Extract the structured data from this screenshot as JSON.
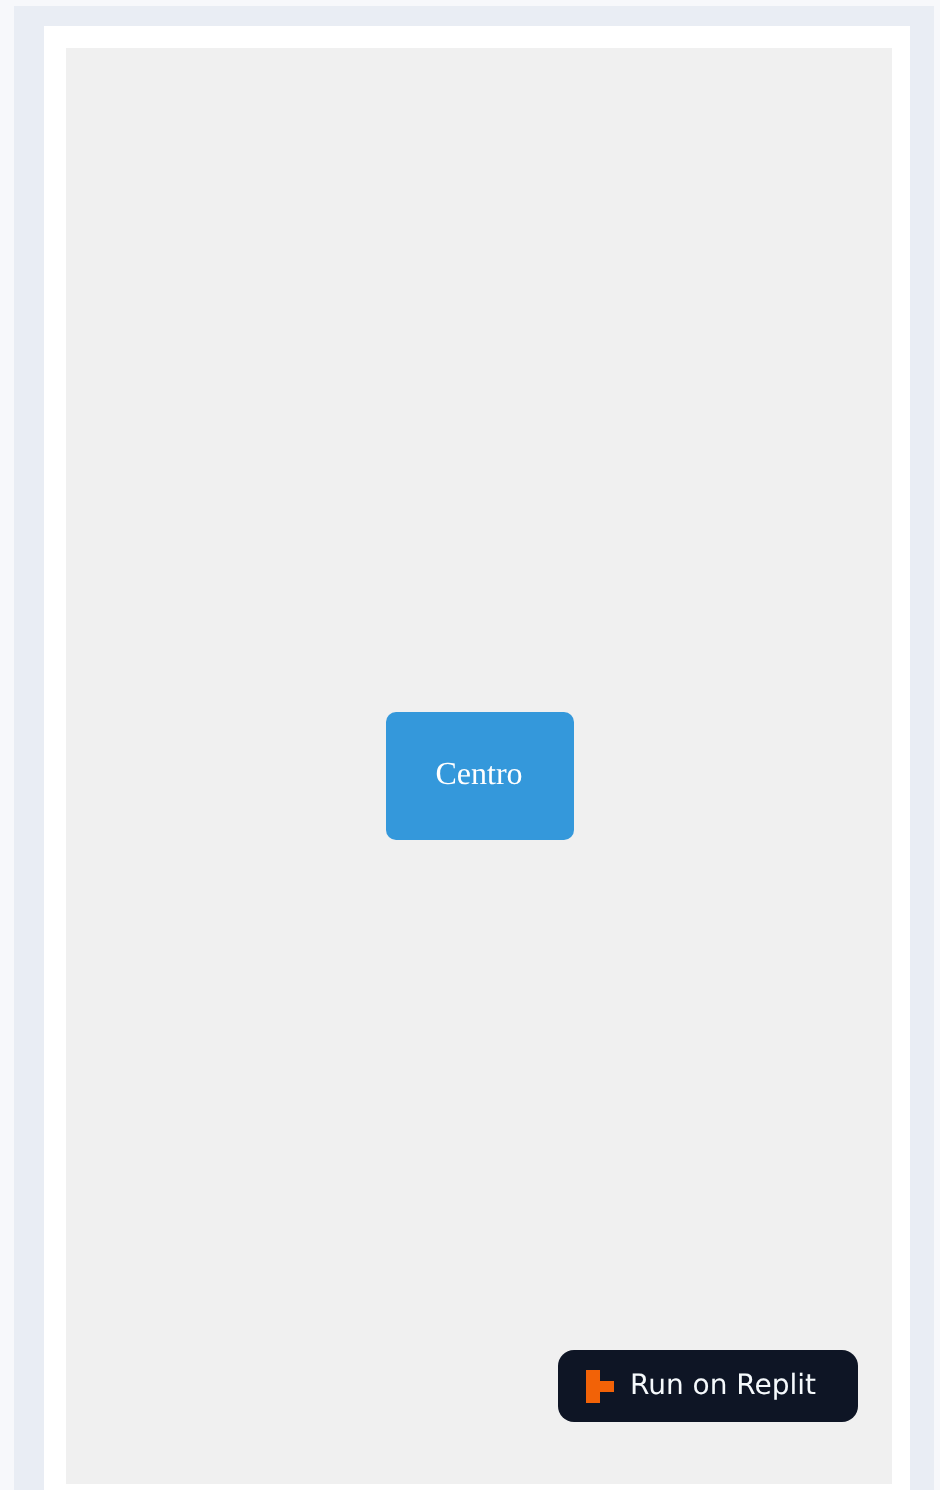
{
  "center_button": {
    "label": "Centro"
  },
  "replit_badge": {
    "label": "Run on Replit"
  }
}
